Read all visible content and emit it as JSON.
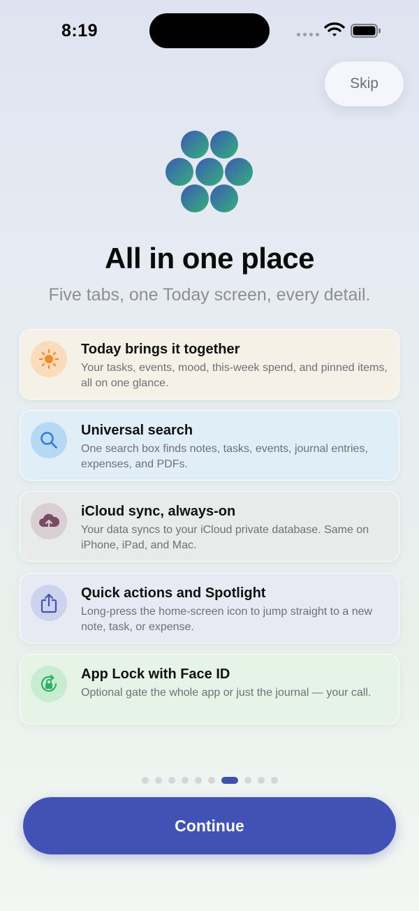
{
  "status_bar": {
    "time": "8:19"
  },
  "skip_label": "Skip",
  "title": "All in one place",
  "subtitle": "Five tabs, one Today screen, every detail.",
  "colors": {
    "accent": "#4152b4",
    "today": "#f08a24",
    "search": "#2f7fd8",
    "icloud": "#7a4a62",
    "quick": "#3f55b5",
    "lock": "#2eb062"
  },
  "features": [
    {
      "title": "Today brings it together",
      "description": "Your tasks, events, mood, this-week spend, and pinned items, all on one glance.",
      "icon": "sun-icon"
    },
    {
      "title": "Universal search",
      "description": "One search box finds notes, tasks, events, journal entries, expenses, and PDFs.",
      "icon": "search-icon"
    },
    {
      "title": "iCloud sync, always-on",
      "description": "Your data syncs to your iCloud private database. Same on iPhone, iPad, and Mac.",
      "icon": "icloud-upload-icon"
    },
    {
      "title": "Quick actions and Spotlight",
      "description": "Long-press the home-screen icon to jump straight to a new note, task, or expense.",
      "icon": "share-icon"
    },
    {
      "title": "App Lock with Face ID",
      "description": "Optional gate the whole app or just the journal — your call.",
      "icon": "lock-rotation-icon"
    }
  ],
  "pagination": {
    "total": 10,
    "current": 7
  },
  "continue_label": "Continue"
}
